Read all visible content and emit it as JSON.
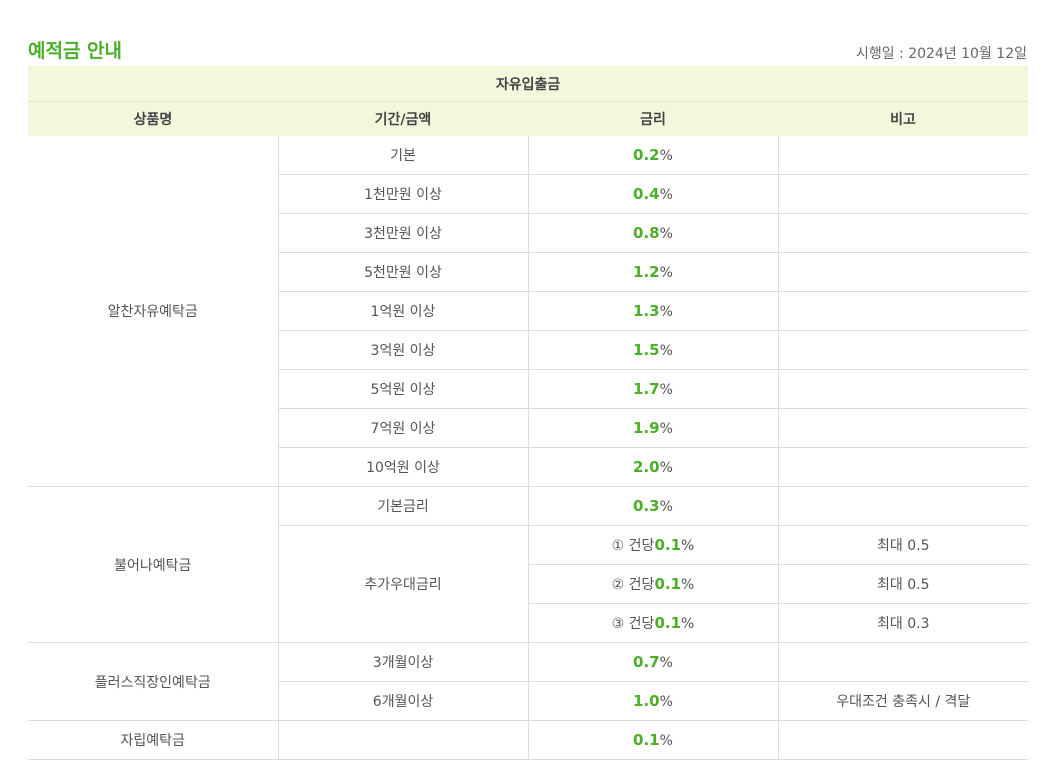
{
  "header": {
    "title": "예적금 안내",
    "effective_date": "시행일 : 2024년 10월 12일"
  },
  "table": {
    "group_label": "자유입출금",
    "columns": [
      "상품명",
      "기간/금액",
      "금리",
      "비고"
    ],
    "products": [
      {
        "name": "알찬자유예탁금",
        "rows": [
          {
            "cond": "기본",
            "rate": "0.2",
            "note": ""
          },
          {
            "cond": "1천만원 이상",
            "rate": "0.4",
            "note": ""
          },
          {
            "cond": "3천만원 이상",
            "rate": "0.8",
            "note": ""
          },
          {
            "cond": "5천만원 이상",
            "rate": "1.2",
            "note": ""
          },
          {
            "cond": "1억원 이상",
            "rate": "1.3",
            "note": ""
          },
          {
            "cond": "3억원 이상",
            "rate": "1.5",
            "note": ""
          },
          {
            "cond": "5억원 이상",
            "rate": "1.7",
            "note": ""
          },
          {
            "cond": "7억원 이상",
            "rate": "1.9",
            "note": ""
          },
          {
            "cond": "10억원 이상",
            "rate": "2.0",
            "note": ""
          }
        ]
      },
      {
        "name": "불어나예탁금",
        "base": {
          "cond": "기본금리",
          "rate": "0.3",
          "note": ""
        },
        "bonus_label": "추가우대금리",
        "bonus_rows": [
          {
            "prefix": "① 건당",
            "rate": "0.1",
            "note": "최대 0.5"
          },
          {
            "prefix": "② 건당",
            "rate": "0.1",
            "note": "최대 0.5"
          },
          {
            "prefix": "③ 건당",
            "rate": "0.1",
            "note": "최대 0.3"
          }
        ]
      },
      {
        "name": "플러스직장인예탁금",
        "rows": [
          {
            "cond": "3개월이상",
            "rate": "0.7",
            "note": ""
          },
          {
            "cond": "6개월이상",
            "rate": "1.0",
            "note": "우대조건 충족시 / 격달"
          }
        ]
      },
      {
        "name": "자립예탁금",
        "rows": [
          {
            "cond": "",
            "rate": "0.1",
            "note": ""
          }
        ]
      }
    ],
    "percent_sign": "%"
  },
  "colors": {
    "accent_green": "#4caf28",
    "header_bg": "#f3f7dc",
    "border": "#dcdcdc"
  }
}
